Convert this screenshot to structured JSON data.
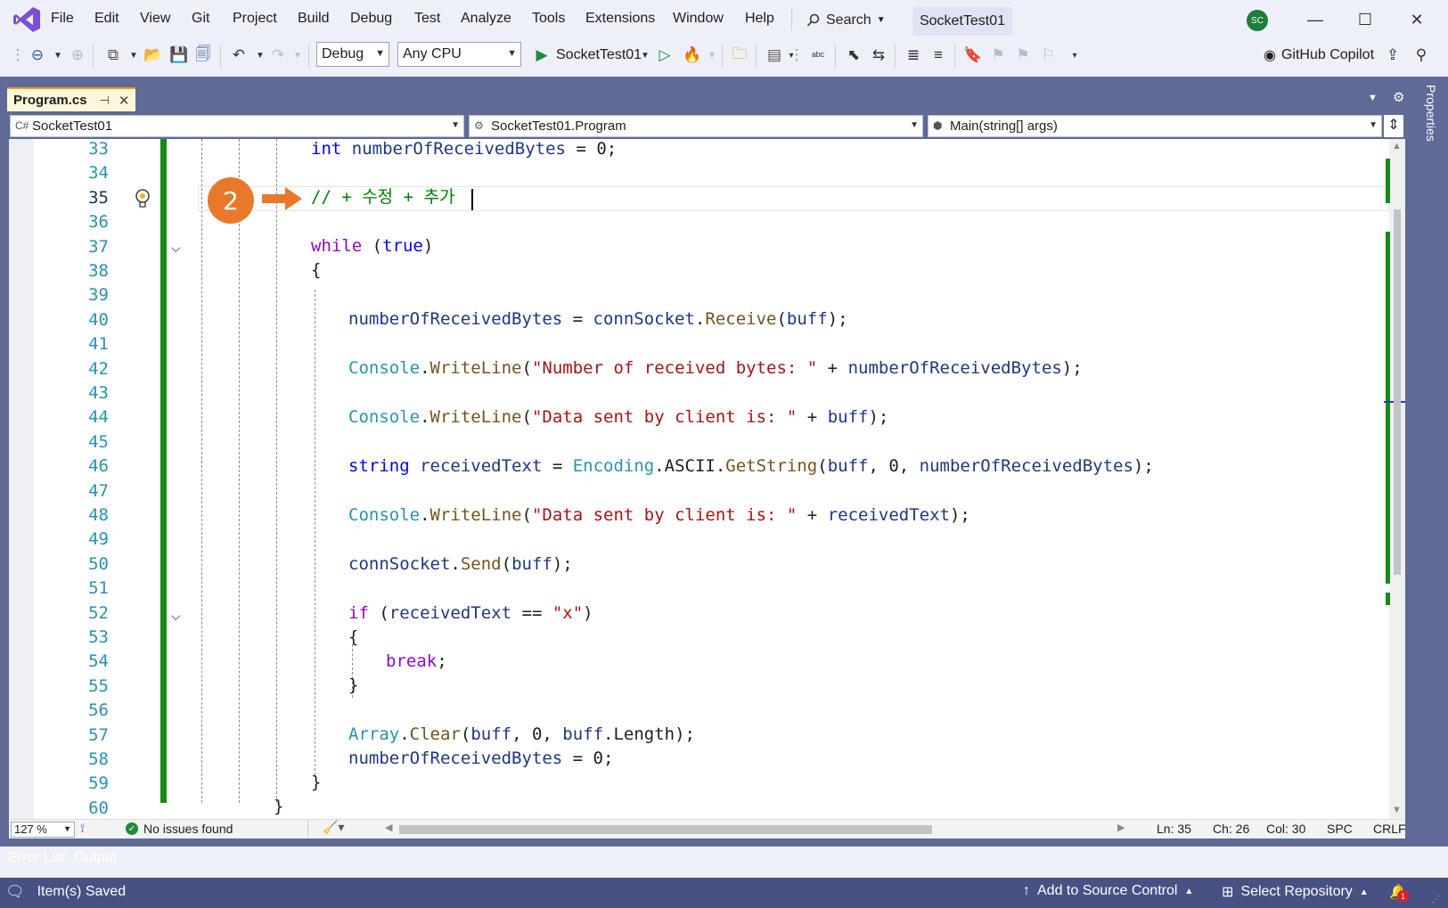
{
  "menu": [
    "File",
    "Edit",
    "View",
    "Git",
    "Project",
    "Build",
    "Debug",
    "Test",
    "Analyze",
    "Tools",
    "Extensions",
    "Window",
    "Help"
  ],
  "search": {
    "label": "Search"
  },
  "solution_name": "SocketTest01",
  "user_initials": "SC",
  "toolbar": {
    "configuration": "Debug",
    "platform": "Any CPU",
    "run_target": "SocketTest01",
    "copilot_label": "GitHub Copilot"
  },
  "document_tab": {
    "title": "Program.cs"
  },
  "properties_label": "Properties",
  "nav": {
    "project": "SocketTest01",
    "type": "SocketTest01.Program",
    "member": "Main(string[] args)"
  },
  "line_numbers": [
    "33",
    "34",
    "35",
    "36",
    "37",
    "38",
    "39",
    "40",
    "41",
    "42",
    "43",
    "44",
    "45",
    "46",
    "47",
    "48",
    "49",
    "50",
    "51",
    "52",
    "53",
    "54",
    "55",
    "56",
    "57",
    "58",
    "59",
    "60"
  ],
  "current_line": "35",
  "callout": {
    "number": "2"
  },
  "editor_status": {
    "zoom": "127 %",
    "issues": "No issues found",
    "ln": "Ln: 35",
    "ch": "Ch: 26",
    "col": "Col: 30",
    "spacing": "SPC",
    "line_ending": "CRLF"
  },
  "tool_tabs": [
    "Error List",
    "Output"
  ],
  "statusbar": {
    "message": "Item(s) Saved",
    "source_control": "Add to Source Control",
    "repository": "Select Repository",
    "notification_count": "1"
  },
  "colors": {
    "accent": "#e8782a",
    "statusbar": "#485184",
    "change_bar": "#168a16"
  }
}
